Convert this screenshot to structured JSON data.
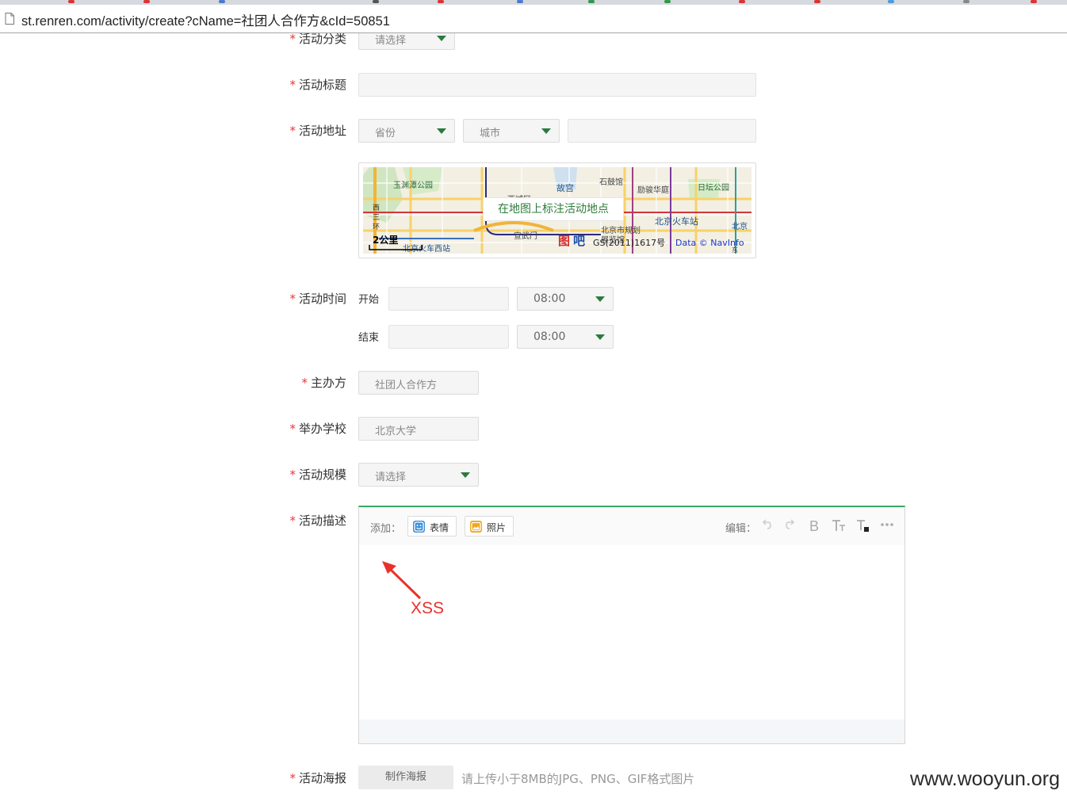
{
  "browser": {
    "url": "st.renren.com/activity/create?cName=社团人合作方&cId=50851"
  },
  "form": {
    "category": {
      "label": "活动分类",
      "value": "请选择"
    },
    "title": {
      "label": "活动标题",
      "value": ""
    },
    "address": {
      "label": "活动地址",
      "province": "省份",
      "city": "城市",
      "detail": "",
      "map_button": "在地图上标注活动地点",
      "map_labels": {
        "park1": "玉渊潭公园",
        "forbidden_city": "故宫",
        "drum_tower": "石鼓馆",
        "hotel": "励骏华庭",
        "ritan": "日坛公园",
        "xisanhuan_1": "西",
        "xisanhuan_2": "三",
        "xisanhuan_3": "环",
        "xicheng": "西城区",
        "beijing_station": "北京火车站",
        "beijing_short": "北京",
        "planning": "北京市规划",
        "planning2": "展览馆",
        "xuanwumen": "宣武门",
        "west_station": "北京火车西站",
        "scale": "2公里",
        "logo_1": "图",
        "logo_2": "吧",
        "copyright": "GS(2011)1617号",
        "data_credit": "Data © NavInfo",
        "dong": "东"
      }
    },
    "time": {
      "label": "活动时间",
      "start_label": "开始",
      "start_date": "",
      "start_time": "08:00",
      "end_label": "结束",
      "end_date": "",
      "end_time": "08:00"
    },
    "organizer": {
      "label": "主办方",
      "value": "社团人合作方"
    },
    "school": {
      "label": "举办学校",
      "value": "北京大学"
    },
    "scale": {
      "label": "活动规模",
      "value": "请选择"
    },
    "description": {
      "label": "活动描述",
      "add_label": "添加：",
      "emoji_button": "表情",
      "photo_button": "照片",
      "edit_label": "编辑：",
      "tool_icons": [
        "undo-icon",
        "redo-icon",
        "bold-icon",
        "font-size-icon",
        "text-color-icon",
        "more-icon"
      ]
    },
    "poster": {
      "label": "活动海报",
      "button": "制作海报",
      "hint": "请上传小于8MB的JPG、PNG、GIF格式图片"
    },
    "required_mark": "*"
  },
  "annotation": {
    "text": "XSS",
    "color": "#e8312c"
  },
  "watermark": "www.wooyun.org",
  "colors": {
    "accent_green": "#2a7b3d",
    "required_red": "#e4393c",
    "editor_border": "#3aa864"
  }
}
